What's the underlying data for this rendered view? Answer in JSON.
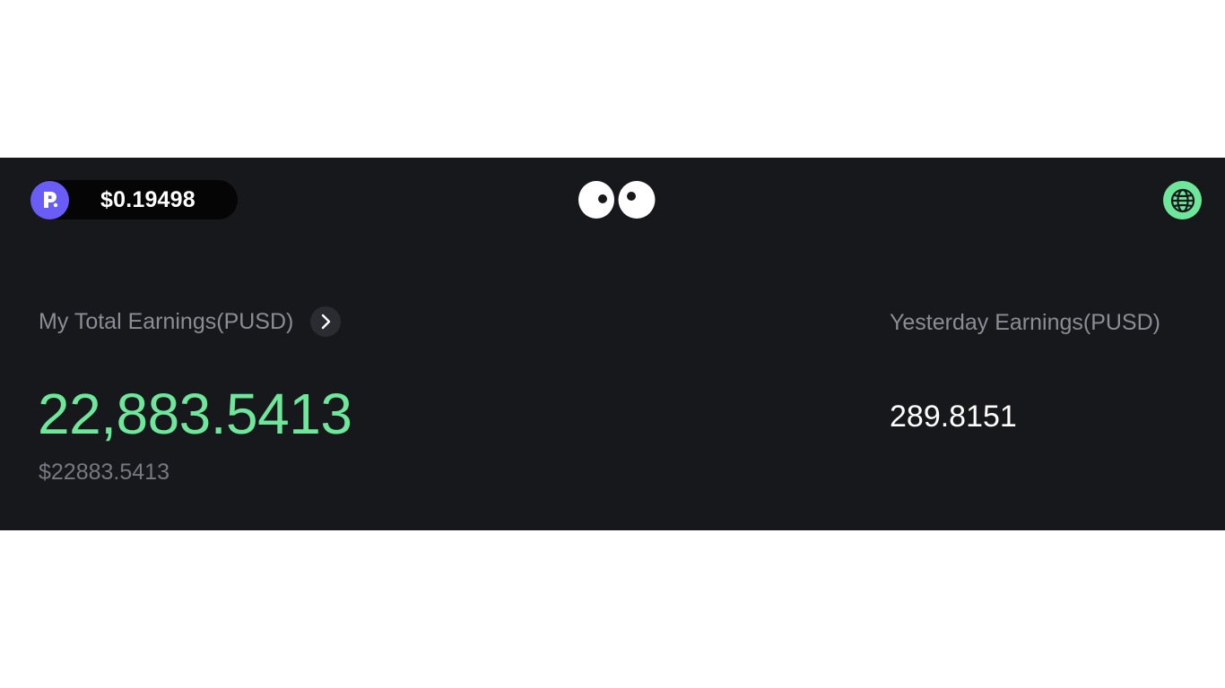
{
  "header": {
    "balance": "$0.19498",
    "token_icon": "p-token-icon",
    "logo_icon": "eyes-logo-icon",
    "globe_icon": "globe-icon"
  },
  "earnings": {
    "total_label": "My Total Earnings(PUSD)",
    "total_value": "22,883.5413",
    "total_usd": "$22883.5413",
    "yesterday_label": "Yesterday Earnings(PUSD)",
    "yesterday_value": "289.8151"
  },
  "colors": {
    "background": "#17181c",
    "accent_green": "#6ee79a",
    "token_purple": "#6a5cf6"
  }
}
